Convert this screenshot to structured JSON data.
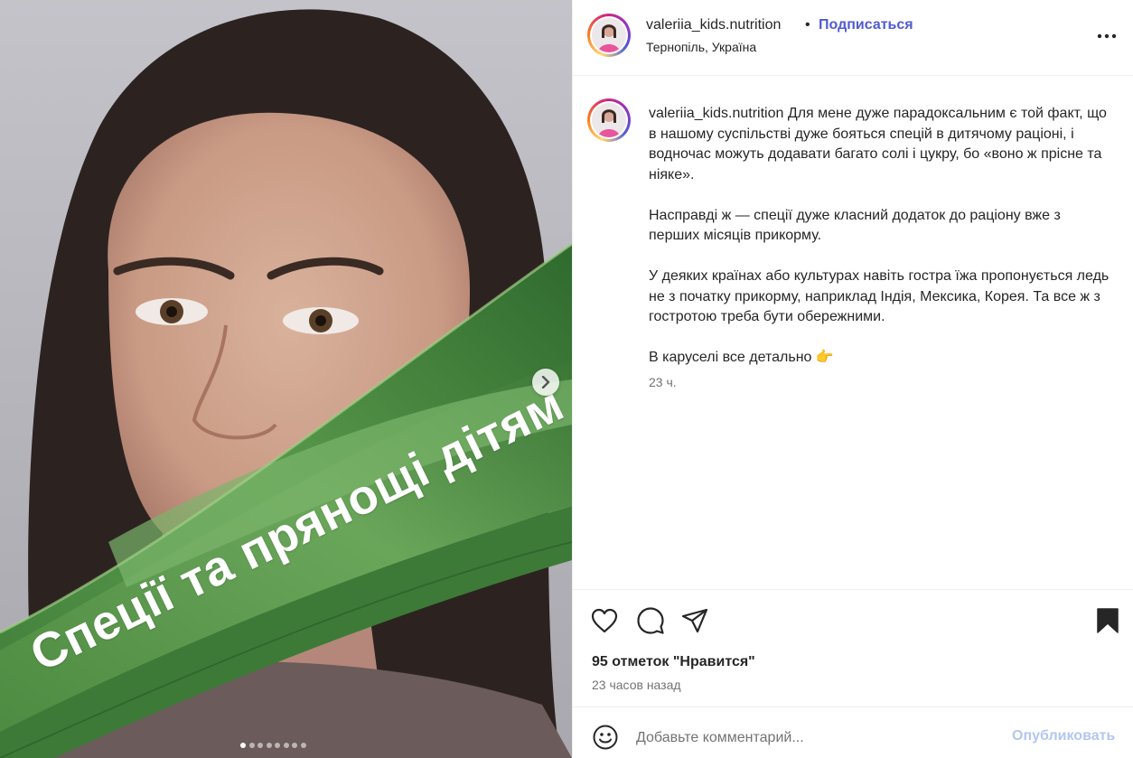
{
  "post": {
    "overlay_text": "Спеції та прянощі дітям",
    "carousel": {
      "total": 8,
      "current": 1
    }
  },
  "header": {
    "username": "valeriia_kids.nutrition",
    "separator": "•",
    "follow_label": "Подписаться",
    "location": "Тернопіль, Україна"
  },
  "caption": {
    "username": "valeriia_kids.nutrition",
    "paragraph_1": "Для мене дуже парадоксальним є той факт, що в нашому суспільстві дуже бояться спецій в дитячому раціоні, і водночас можуть додавати багато солі і цукру, бо «воно ж прісне та ніяке».",
    "paragraph_2": "Насправді ж — спеції дуже класний додаток до раціону вже з перших місяців прикорму.",
    "paragraph_3": "У деяких країнах або культурах навіть гостра їжа пропонується ледь не з початку прикорму, наприклад Індія, Мексика, Корея. Та все ж з гостротою треба бути обережними.",
    "paragraph_4": "В каруселі все детально 👉",
    "time": "23 ч."
  },
  "actions": {
    "likes": "95 отметок \"Нравится\"",
    "posted": "23 часов назад",
    "icons": [
      "heart-icon",
      "comment-icon",
      "share-icon",
      "bookmark-icon"
    ]
  },
  "comment": {
    "placeholder": "Добавьте комментарий...",
    "publish_label": "Опубликовать"
  },
  "colors": {
    "accent": "#4f5bd5",
    "publish_disabled": "#b3c6f3",
    "muted": "#737373",
    "text": "#262626"
  }
}
